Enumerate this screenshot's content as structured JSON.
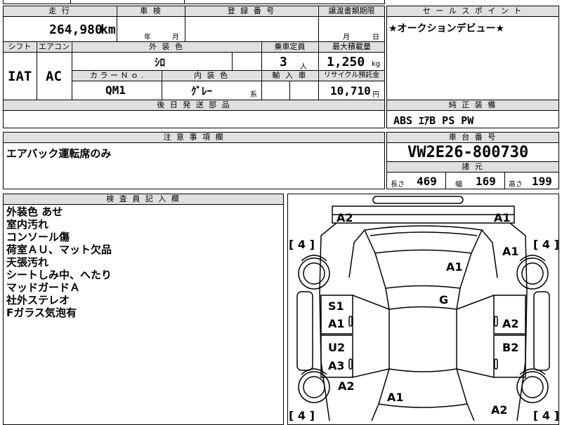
{
  "top_partial": "",
  "mileage": {
    "header": "走 行",
    "value": "264,980",
    "unit": "km"
  },
  "shaken": {
    "header": "車 検",
    "year_label": "年",
    "month_label": "月"
  },
  "registration": {
    "header": "登 録 番 号"
  },
  "transfer_docs": {
    "header": "譲渡書類期限",
    "month_label": "月",
    "day_label": "日"
  },
  "shift": {
    "header": "シフト",
    "value": "IAT"
  },
  "aircon": {
    "header": "エアコン",
    "value": "AC"
  },
  "exterior_color": {
    "header": "外 装 色",
    "value": "ｼﾛ"
  },
  "capacity": {
    "header": "乗車定員",
    "value": "3",
    "unit": "人"
  },
  "max_load": {
    "header": "最大積載量",
    "value": "1,250",
    "unit": "kg"
  },
  "color_no": {
    "header": "カ ラ ー Ｎ ｏ .",
    "value": "QM1"
  },
  "interior_color": {
    "header": "内 装 色",
    "value": "ｸﾞﾚｰ",
    "suffix": "系"
  },
  "import": {
    "header": "輸 入 車"
  },
  "recycle": {
    "header": "リサイクル預託金",
    "value": "10,710",
    "unit": "円"
  },
  "later_parts": {
    "header": "後 日 発 送 部 品"
  },
  "sales_point": {
    "header": "セ ー ル ス ポ イ ン ト",
    "text": "★オークションデビュー★"
  },
  "genuine_equipment": {
    "header": "純 正 装 備",
    "text": "ABS ｴｱB PS PW"
  },
  "caution": {
    "header": "注 意 事 項 欄",
    "text": "エアバック運転席のみ"
  },
  "chassis": {
    "header": "車 台 番 号",
    "value": "VW2E26-800730"
  },
  "specs": {
    "header": "諸 元",
    "length_label": "長さ",
    "length": "469",
    "width_label": "幅",
    "width": "169",
    "height_label": "高さ",
    "height": "199"
  },
  "inspector": {
    "header": "検 査 員 記 入 欄",
    "lines": [
      "外装色 あせ",
      "室内汚れ",
      "コンソール傷",
      "荷室ＡＵ、マット欠品",
      "天張汚れ",
      "シートしみ中、へたり",
      "マッドガードＡ",
      "社外ステレオ",
      "Fガラス気泡有"
    ]
  },
  "diagram": {
    "tires": [
      "[ 4 ]",
      "[ 4 ]",
      "[ 4 ]",
      "[ 4 ]"
    ],
    "marks": [
      "A2",
      "A1",
      "A1",
      "A1",
      "G",
      "S1",
      "A1",
      "A2",
      "U2",
      "B2",
      "A3",
      "A2",
      "A1",
      "A2"
    ]
  }
}
